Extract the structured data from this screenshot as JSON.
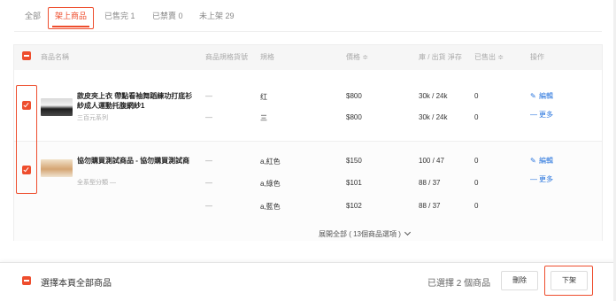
{
  "tabs": [
    {
      "label": "全部"
    },
    {
      "label": "架上商品",
      "active": true
    },
    {
      "label": "已售完 1"
    },
    {
      "label": "已禁賣 0"
    },
    {
      "label": "未上架 29"
    }
  ],
  "table": {
    "headers": {
      "name": "商品名稱",
      "sku": "商品規格貨號",
      "variation": "規格",
      "price": "價格 ≑",
      "stock": "庫 / 出貨 淨存",
      "sold": "已售出 ≑",
      "actions": "操作"
    },
    "products": [
      {
        "name": "款皮夾上衣 帶點看袖舞蹈練功打底衫紗成人運動托腹網紗1",
        "sub": "三百元系列",
        "variations": [
          {
            "sku": "—",
            "variation": "红",
            "price": "$800",
            "stock": "30k / 24k",
            "sold": "0"
          },
          {
            "sku": "—",
            "variation": "三",
            "price": "$800",
            "stock": "30k / 24k",
            "sold": "0"
          }
        ],
        "actions": {
          "edit": "編輯",
          "more": "更多"
        }
      },
      {
        "name": "協勿購買測試商品 - 協勿購買測試商",
        "sub": "全系型分類 —",
        "variations": [
          {
            "sku": "—",
            "variation": "a,紅色",
            "price": "$150",
            "stock": "100 / 47",
            "sold": "0"
          },
          {
            "sku": "—",
            "variation": "a,綠色",
            "price": "$101",
            "stock": "88 / 37",
            "sold": "0"
          },
          {
            "sku": "—",
            "variation": "a,藍色",
            "price": "$102",
            "stock": "88 / 37",
            "sold": "0"
          }
        ],
        "actions": {
          "edit": "編輯",
          "more": "更多"
        }
      }
    ],
    "expand_label": "展開全部 ( 13個商品選項 )"
  },
  "bottom": {
    "select_all_label": "選擇本頁全部商品",
    "selected_count": "已選擇 2 個商品",
    "delete_label": "刪除",
    "delist_label": "下架"
  },
  "icons": {
    "edit": "edit-icon",
    "more": "more-icon",
    "expand": "chevron-down-icon"
  },
  "colors": {
    "accent": "#ee4d2d",
    "link": "#2673dd"
  }
}
